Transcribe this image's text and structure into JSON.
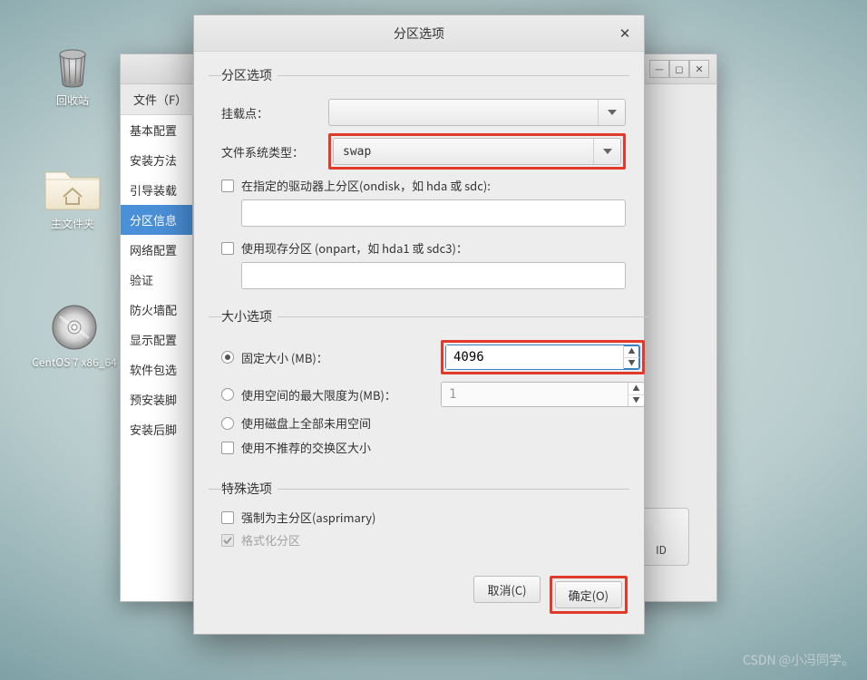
{
  "desktop": {
    "trash_label": "回收站",
    "home_label": "主文件夹",
    "disc_label": "CentOS 7 x86_64"
  },
  "bg_window": {
    "menu_file": "文件（F）",
    "min_icon": "minimize",
    "max_icon": "maximize",
    "close_icon": "close",
    "sidebar_items": [
      "基本配置",
      "安装方法",
      "引导装载",
      "分区信息",
      "网络配置",
      "验证",
      "防火墙配",
      "显示配置",
      "软件包选",
      "预安装脚",
      "安装后脚"
    ],
    "raid_btn": "ID"
  },
  "dialog": {
    "title": "分区选项",
    "close_icon": "close",
    "section_partition": "分区选项",
    "mount_point_label": "挂载点：",
    "mount_point_value": "",
    "fs_type_label": "文件系统类型：",
    "fs_type_value": "swap",
    "ondisk_check": "在指定的驱动器上分区(ondisk，如 hda 或 sdc):",
    "ondisk_value": "",
    "onpart_check": "使用现存分区 (onpart，如 hda1 或 sdc3)：",
    "onpart_value": "",
    "section_size": "大小选项",
    "size_fixed_label": "固定大小 (MB)：",
    "size_fixed_value": "4096",
    "size_max_label": "使用空间的最大限度为(MB)：",
    "size_max_value": "1",
    "size_fill_label": "使用磁盘上全部未用空间",
    "size_norecommend_label": "使用不推荐的交换区大小",
    "section_special": "特殊选项",
    "asprimary_label": "强制为主分区(asprimary)",
    "format_label": "格式化分区",
    "cancel_btn": "取消(C)",
    "ok_btn": "确定(O)"
  },
  "watermark": "CSDN @小冯同学。"
}
